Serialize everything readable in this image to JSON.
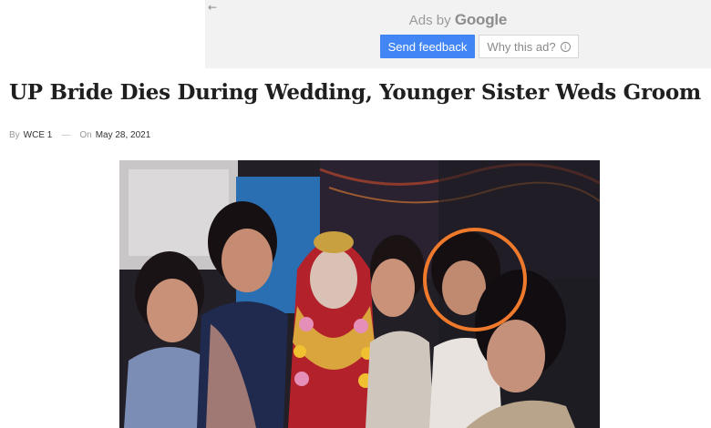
{
  "ad": {
    "ads_by_prefix": "Ads by",
    "ads_by_brand": "Google",
    "send_feedback": "Send feedback",
    "why_this_ad": "Why this ad?",
    "back_icon": "arrow-left-icon",
    "info_icon": "info-icon",
    "accent": "#4285f4"
  },
  "article": {
    "title": "UP Bride Dies During Wedding, Younger Sister Weds Groom",
    "by_label": "By",
    "author": "WCE 1",
    "dash": "—",
    "on_label": "On",
    "date": "May 28, 2021"
  },
  "photo": {
    "highlight_color": "#f07a2c"
  }
}
